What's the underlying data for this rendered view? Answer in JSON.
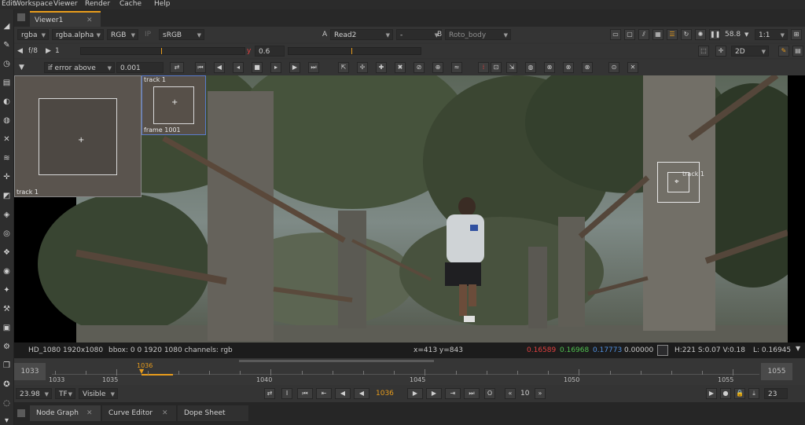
{
  "menu": [
    "Edit",
    "Workspace",
    "Viewer",
    "Render",
    "Cache",
    "Help"
  ],
  "viewer_tab": {
    "label": "Viewer1",
    "close": "✕"
  },
  "controls_row1": {
    "channel_set": "rgba",
    "display_channel": "rgba.alpha",
    "color_mode": "RGB",
    "ip_label": "IP",
    "lut": "sRGB",
    "input_a_label": "A",
    "input_a": "Read2",
    "blend": "-",
    "input_b_label": "B",
    "input_b": "Roto_body",
    "zoom_percent": "58.8",
    "zoom_ratio": "1:1"
  },
  "controls_row2": {
    "fstop": "f/8",
    "gain": "1",
    "y_label": "y",
    "gamma": "0.6",
    "view_mode": "2D"
  },
  "controls_row3": {
    "error_mode": "if error above",
    "threshold": "0.001"
  },
  "viewer": {
    "zoom_window_label": "track 1",
    "ref_window_top_label": "track 1",
    "ref_window_bottom_label": "frame 1001",
    "track_label": "track 1"
  },
  "infobar": {
    "format": "HD_1080 1920x1080",
    "bbox": "bbox: 0 0 1920 1080 channels: rgb",
    "coords": "x=413 y=843",
    "r": "0.16589",
    "g": "0.16968",
    "b": "0.17773",
    "a": "0.00000",
    "hsv": "H:221 S:0.07 V:0.18",
    "lum": "L: 0.16945",
    "colors": {
      "r": "#e04040",
      "g": "#4fc04f",
      "b": "#4f8fe0",
      "swatch": "#2b2b2d"
    }
  },
  "timeline": {
    "in_frame": "1033",
    "out_frame": "1055",
    "current": "1036",
    "ticks": [
      "1033",
      "1035",
      "1040",
      "1045",
      "1050",
      "1055"
    ],
    "accent": "#e89c1c"
  },
  "transport": {
    "fps": "23.98",
    "tf": "TF",
    "visible": "Visible",
    "current_frame": "1036",
    "loop_char": "O",
    "step": "10",
    "end_field": "23"
  },
  "bottom_tabs": [
    "Node Graph",
    "Curve Editor",
    "Dope Sheet"
  ],
  "icons": {
    "play": "play-icon",
    "stop": "stop-icon",
    "rewind": "rewind-icon",
    "close": "close-icon"
  }
}
